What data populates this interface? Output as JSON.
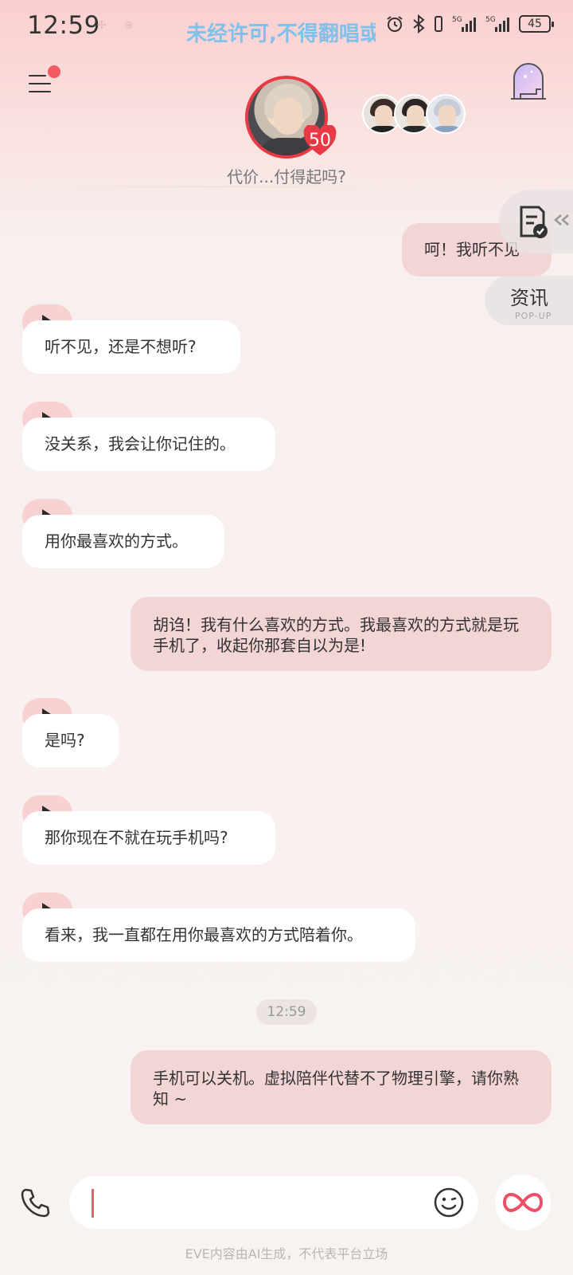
{
  "status_bar": {
    "time": "12:59",
    "banner": "未经许可,不得翻唱或",
    "battery": "45"
  },
  "header": {
    "level": "50",
    "subtitle": "代价...付得起吗?"
  },
  "side_widgets": {
    "news_label": "资讯",
    "news_sublabel": "POP-UP"
  },
  "messages": [
    {
      "from": "user",
      "text": "呵！我听不见"
    },
    {
      "from": "ai",
      "text": "听不见，还是不想听?"
    },
    {
      "from": "ai",
      "text": "没关系，我会让你记住的。"
    },
    {
      "from": "ai",
      "text": "用你最喜欢的方式。"
    },
    {
      "from": "user",
      "text": "胡诌！我有什么喜欢的方式。我最喜欢的方式就是玩手机了，收起你那套自以为是!"
    },
    {
      "from": "ai",
      "text": "是吗?"
    },
    {
      "from": "ai",
      "text": "那你现在不就在玩手机吗?"
    },
    {
      "from": "ai",
      "text": "看来，我一直都在用你最喜欢的方式陪着你。"
    },
    {
      "from": "user",
      "text": "手机可以关机。虚拟陪伴代替不了物理引擎，请你熟知 ~"
    }
  ],
  "timestamp": "12:59",
  "input": {
    "value": ""
  },
  "footer_note": "EVE内容由AI生成，不代表平台立场",
  "colors": {
    "accent": "#e83a45",
    "user_bubble": "#f4d5d5",
    "ai_bubble": "#ffffff",
    "play_tab": "#f8d2d2"
  }
}
